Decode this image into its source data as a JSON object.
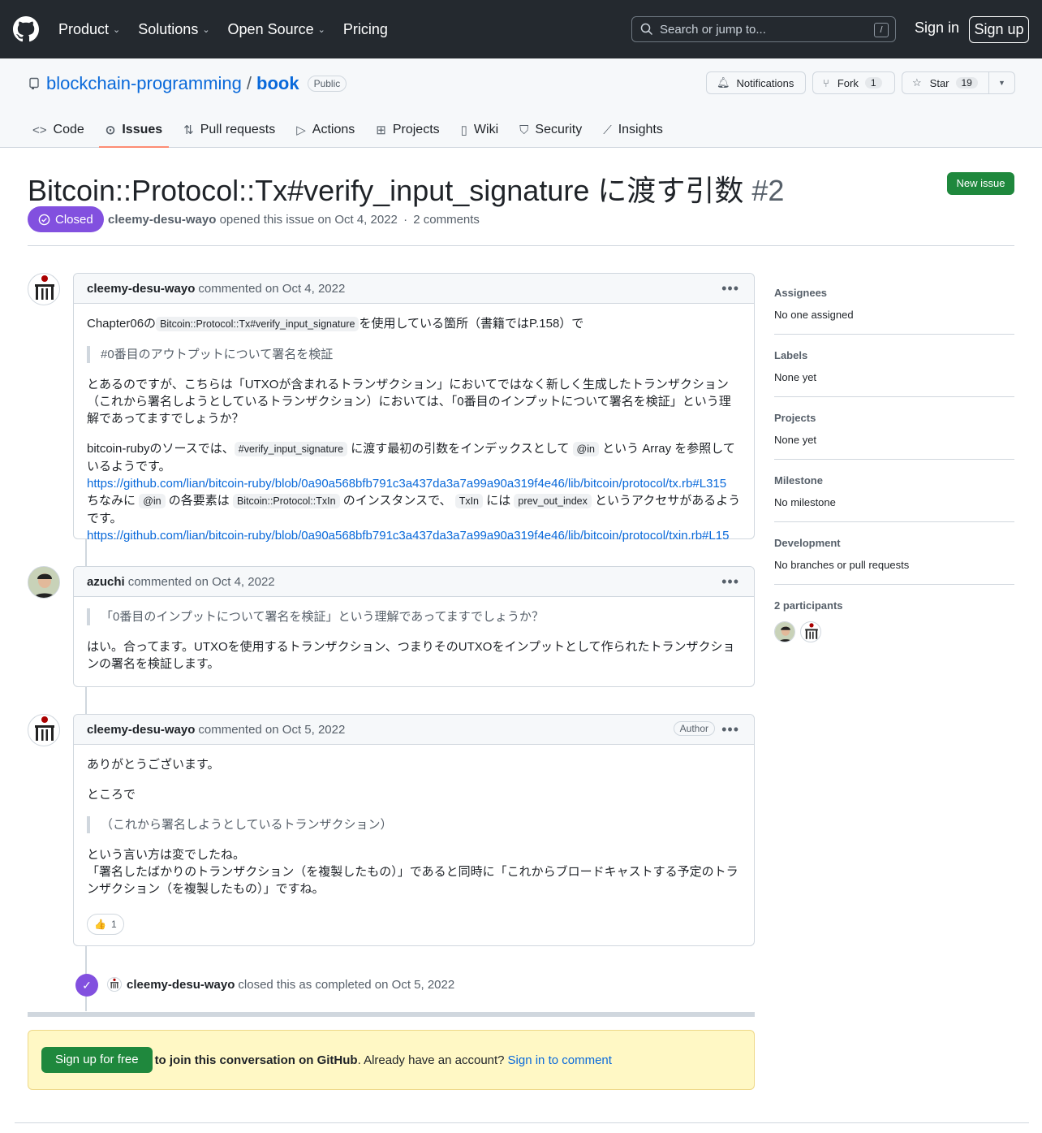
{
  "header": {
    "nav": [
      "Product",
      "Solutions",
      "Open Source",
      "Pricing"
    ],
    "search_placeholder": "Search or jump to...",
    "search_shortcut": "/",
    "sign_in": "Sign in",
    "sign_up": "Sign up"
  },
  "repo": {
    "owner": "blockchain-programming",
    "separator": "/",
    "name": "book",
    "visibility": "Public",
    "notifications_label": "Notifications",
    "fork_label": "Fork",
    "fork_count": "1",
    "star_label": "Star",
    "star_count": "19"
  },
  "tabs": [
    "Code",
    "Issues",
    "Pull requests",
    "Actions",
    "Projects",
    "Wiki",
    "Security",
    "Insights"
  ],
  "issue": {
    "title": "Bitcoin::Protocol::Tx#verify_input_signature に渡す引数",
    "number": "#2",
    "new_issue_label": "New issue",
    "state": "Closed",
    "author": "cleemy-desu-wayo",
    "opened_text": "opened this issue on Oct 4, 2022",
    "dot": "·",
    "comments_count": "2 comments"
  },
  "comments": [
    {
      "author": "cleemy-desu-wayo",
      "meta": "commented on Oct 4, 2022",
      "p1_a": "Chapter06の",
      "p1_code": "Bitcoin::Protocol::Tx#verify_input_signature",
      "p1_b": "を使用している箇所（書籍ではP.158）で",
      "quote": "#0番目のアウトプットについて署名を検証",
      "p2": "とあるのですが、こちらは「UTXOが含まれるトランザクション」においてではなく新しく生成したトランザクション（これから署名しようとしているトランザクション）においては、「0番目のインプットについて署名を検証」という理解であってますでしょうか？",
      "p3_a": "bitcoin-rubyのソースでは、",
      "p3_code1": "#verify_input_signature",
      "p3_b": "に渡す最初の引数をインデックスとして",
      "p3_code2": "@in",
      "p3_c": "という Array を参照しているようです。",
      "link1": "https://github.com/lian/bitcoin-ruby/blob/0a90a568bfb791c3a437da3a7a99a90a319f4e46/lib/bitcoin/protocol/tx.rb#L315",
      "p4_a": "ちなみに",
      "p4_code1": "@in",
      "p4_b": "の各要素は",
      "p4_code2": "Bitcoin::Protocol::TxIn",
      "p4_c": "のインスタンスで、",
      "p4_code3": "TxIn",
      "p4_d": "には",
      "p4_code4": "prev_out_index",
      "p4_e": "というアクセサがあるようです。",
      "link2": "https://github.com/lian/bitcoin-ruby/blob/0a90a568bfb791c3a437da3a7a99a90a319f4e46/lib/bitcoin/protocol/txin.rb#L15"
    },
    {
      "author": "azuchi",
      "meta": "commented on Oct 4, 2022",
      "quote": "「0番目のインプットについて署名を検証」という理解であってますでしょうか？",
      "p1": "はい。合ってます。UTXOを使用するトランザクション、つまりそのUTXOをインプットとして作られたトランザクションの署名を検証します。"
    },
    {
      "author": "cleemy-desu-wayo",
      "meta": "commented on Oct 5, 2022",
      "badge": "Author",
      "p1": "ありがとうございます。",
      "p2": "ところで",
      "quote": "（これから署名しようとしているトランザクション）",
      "p3a": "という言い方は変でしたね。",
      "p3b": "「署名したばかりのトランザクション（を複製したもの）」であると同時に「これからブロードキャストする予定のトランザクション（を複製したもの）」ですね。",
      "reaction_emoji": "👍",
      "reaction_count": "1"
    }
  ],
  "event": {
    "actor": "cleemy-desu-wayo",
    "text": "closed this as completed on Oct 5, 2022"
  },
  "join": {
    "signup_button": "Sign up for free",
    "bold_text": "to join this conversation on GitHub",
    "text": ". Already have an account?",
    "link": "Sign in to comment"
  },
  "sidebar": {
    "assignees_h": "Assignees",
    "assignees_v": "No one assigned",
    "labels_h": "Labels",
    "labels_v": "None yet",
    "projects_h": "Projects",
    "projects_v": "None yet",
    "milestone_h": "Milestone",
    "milestone_v": "No milestone",
    "development_h": "Development",
    "development_v": "No branches or pull requests",
    "participants_h": "2 participants"
  },
  "colors": {
    "header_bg": "#24292f",
    "closed_purple": "#8250df",
    "green": "#1f883d",
    "link": "#0969da"
  }
}
